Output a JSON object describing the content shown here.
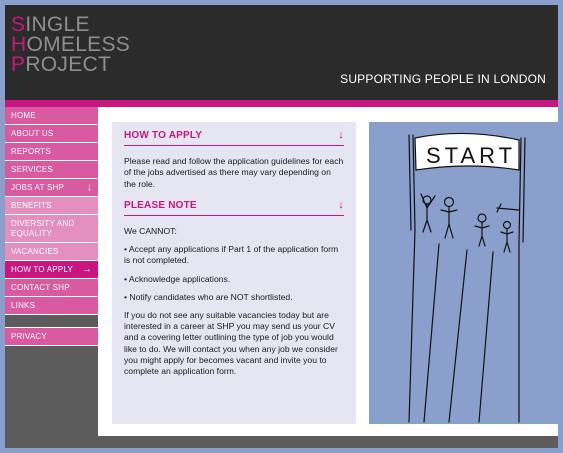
{
  "header": {
    "logo_lines": [
      {
        "initial": "S",
        "rest": "INGLE"
      },
      {
        "initial": "H",
        "rest": "OMELESS"
      },
      {
        "initial": "P",
        "rest": "ROJECT"
      }
    ],
    "tagline": "SUPPORTING PEOPLE IN LONDON"
  },
  "sidebar": {
    "items": [
      {
        "label": "HOME",
        "style": "pink",
        "arrow": ""
      },
      {
        "label": "ABOUT US",
        "style": "pink",
        "arrow": ""
      },
      {
        "label": "REPORTS",
        "style": "pink",
        "arrow": ""
      },
      {
        "label": "SERVICES",
        "style": "pink",
        "arrow": ""
      },
      {
        "label": "JOBS AT SHP",
        "style": "pink",
        "arrow": "↓"
      },
      {
        "label": "BENEFITS",
        "style": "light",
        "arrow": ""
      },
      {
        "label": "DIVERSITY AND EQUALITY",
        "style": "light",
        "arrow": ""
      },
      {
        "label": "VACANCIES",
        "style": "light",
        "arrow": ""
      },
      {
        "label": "HOW TO APPLY",
        "style": "active",
        "arrow": "→"
      },
      {
        "label": "CONTACT SHP",
        "style": "pink",
        "arrow": ""
      },
      {
        "label": "LINKS",
        "style": "pink",
        "arrow": ""
      },
      {
        "label": "PRIVACY",
        "style": "pink",
        "arrow": ""
      }
    ]
  },
  "content": {
    "how_to_apply": {
      "heading": "HOW TO APPLY",
      "arrow": "↓",
      "body": "Please read and follow the application guidelines for each of the jobs advertised as there may vary depending on the role."
    },
    "please_note": {
      "heading": "PLEASE NOTE",
      "arrow": "↓",
      "intro": "We CANNOT:",
      "bullets": [
        "• Accept any applications if Part 1 of the application form is not completed.",
        "• Acknowledge applications.",
        "• Notify candidates who are NOT shortlisted."
      ],
      "closing": "If you do not see any suitable vacancies today but are interested in a career at SHP you may send us your CV and a covering letter outlining the type of job you would like to do. We will contact you when any job we consider you might apply for becomes vacant and invite you to complete an application form."
    }
  },
  "illustration": {
    "banner_text": "START"
  },
  "colors": {
    "brand_pink": "#c8157f",
    "header_bg": "#2b2b2b",
    "panel_blue": "#8a9fcc"
  }
}
